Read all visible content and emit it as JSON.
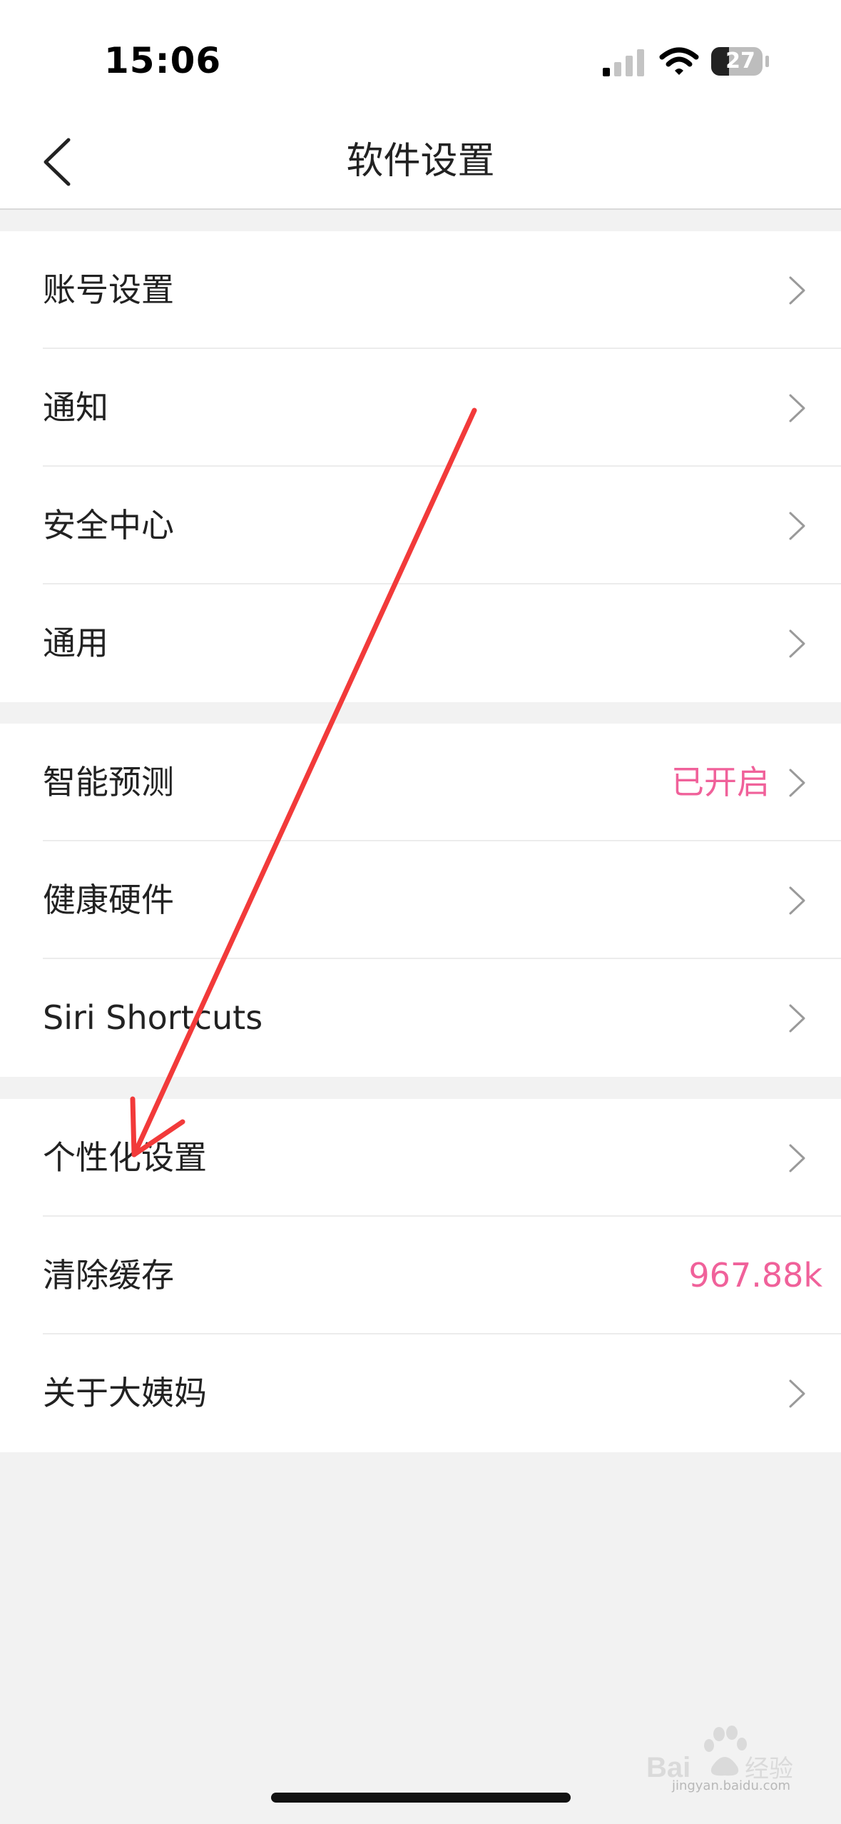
{
  "status_bar": {
    "time": "15:06",
    "battery_level": "27",
    "icons": [
      "signal-icon",
      "wifi-icon",
      "battery-icon"
    ]
  },
  "nav": {
    "title": "软件设置",
    "back_icon": "chevron-left-icon"
  },
  "groups": [
    {
      "items": [
        {
          "label": "账号设置",
          "value": "",
          "chevron": true
        },
        {
          "label": "通知",
          "value": "",
          "chevron": true
        },
        {
          "label": "安全中心",
          "value": "",
          "chevron": true
        },
        {
          "label": "通用",
          "value": "",
          "chevron": true
        }
      ]
    },
    {
      "items": [
        {
          "label": "智能预测",
          "value": "已开启",
          "chevron": true
        },
        {
          "label": "健康硬件",
          "value": "",
          "chevron": true
        },
        {
          "label": "Siri Shortcuts",
          "value": "",
          "chevron": true
        }
      ]
    },
    {
      "items": [
        {
          "label": "个性化设置",
          "value": "",
          "chevron": true
        },
        {
          "label": "清除缓存",
          "value": "967.88k",
          "chevron": false
        },
        {
          "label": "关于大姨妈",
          "value": "",
          "chevron": true
        }
      ]
    }
  ],
  "watermark": {
    "text": "jingyan.baidu.com"
  },
  "colors": {
    "accent_pink": "#f0619a",
    "annotation_red": "#f23a3a",
    "background": "#f2f2f2"
  }
}
